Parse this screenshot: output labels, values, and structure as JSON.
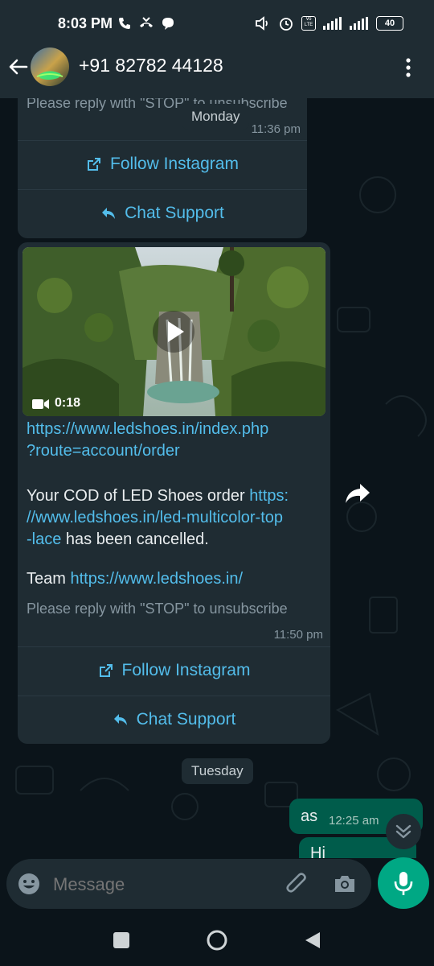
{
  "status": {
    "time": "8:03 PM",
    "battery": "40",
    "volte": "Vo LTE"
  },
  "header": {
    "contact_name": "+91 82782 44128"
  },
  "messages": [
    {
      "partial_text": "Please reply with \"STOP\" to unsubscribe",
      "time": "11:36 pm",
      "follow_label": "Follow Instagram",
      "chat_label": "Chat Support"
    },
    {
      "video_duration": "0:18",
      "link1_line1": "https://www.ledshoes.in/index.php",
      "link1_line2": "?route=account/order",
      "body_prefix": "Your COD of LED Shoes order ",
      "link2_line1": "https:",
      "link2_line2": "//www.ledshoes.in/led-multicolor-top",
      "link2_line3": "-lace",
      "body_suffix": " has been cancelled.",
      "team_prefix": "Team ",
      "team_link": "https://www.ledshoes.in/",
      "unsubscribe": "Please reply with \"STOP\" to unsubscribe",
      "time": "11:50 pm",
      "follow_label": "Follow Instagram",
      "chat_label": "Chat Support"
    }
  ],
  "days": {
    "monday": "Monday",
    "tuesday": "Tuesday"
  },
  "outgoing": [
    {
      "text": "as",
      "time": "12:25 am"
    },
    {
      "text": "Hi",
      "time": ""
    }
  ],
  "input": {
    "placeholder": "Message"
  },
  "colors": {
    "accent": "#00a884",
    "link": "#53bdeb",
    "bubble_in": "#1f2c33",
    "bubble_out": "#005c4b",
    "background": "#0b141a"
  }
}
